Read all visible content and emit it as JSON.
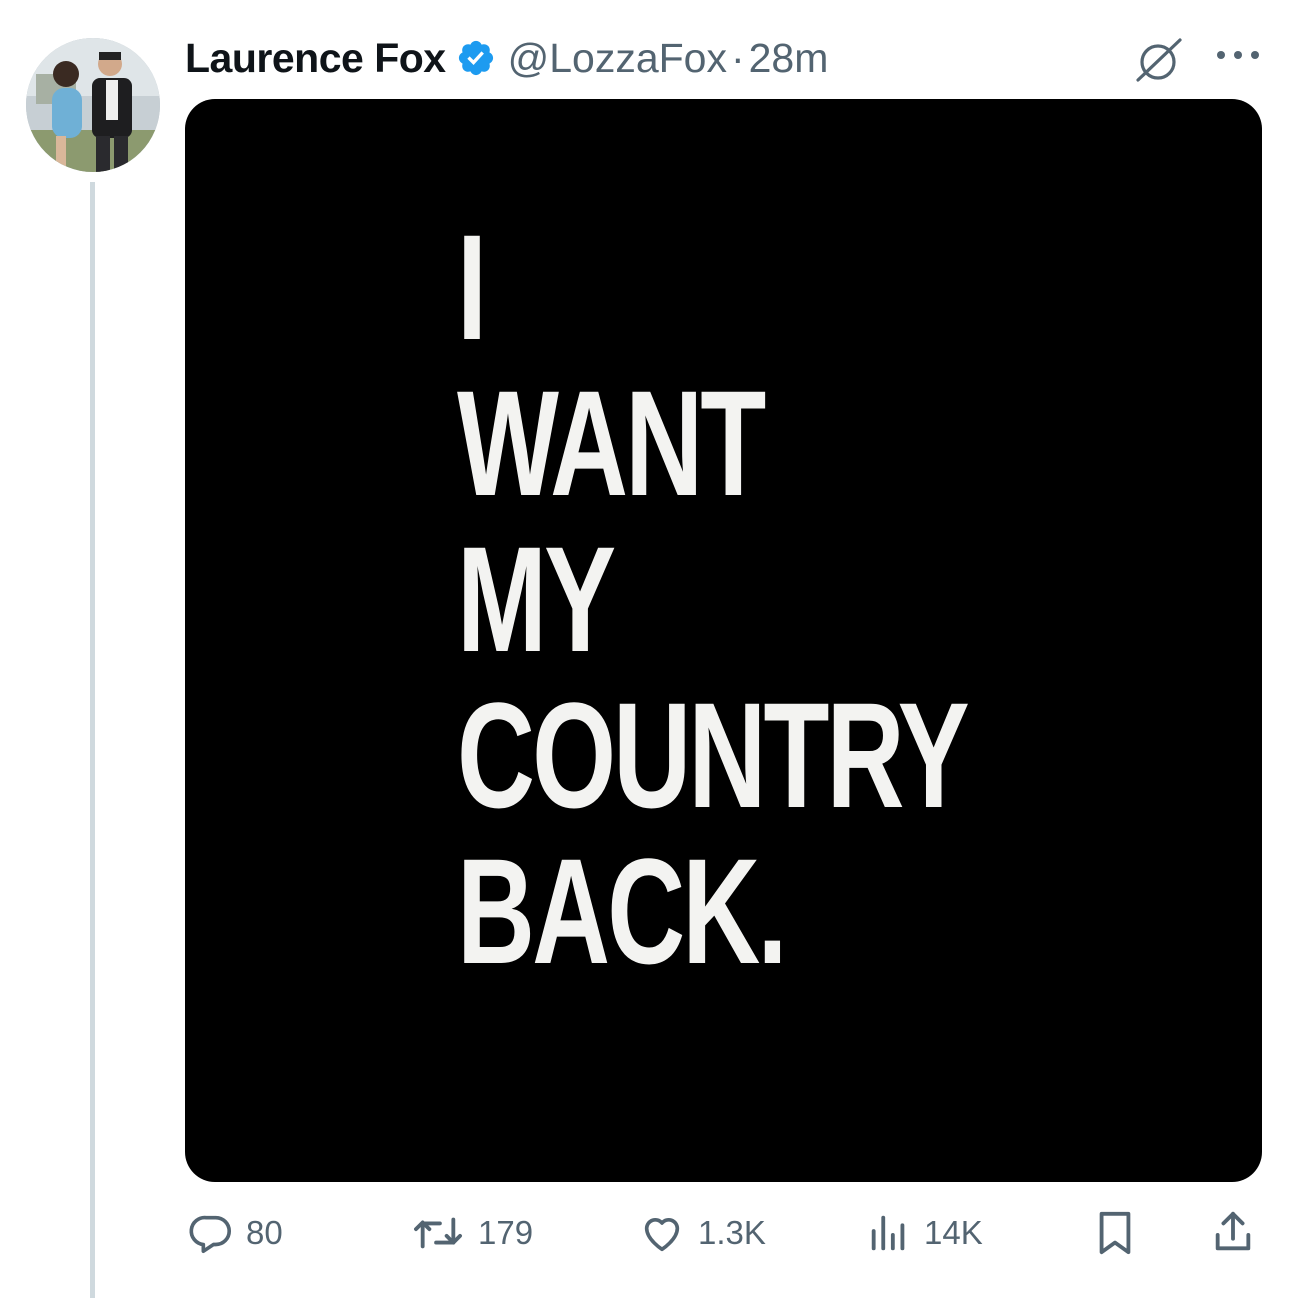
{
  "tweet": {
    "author_name": "Laurence Fox",
    "handle": "@LozzaFox",
    "separator": "·",
    "time": "28m",
    "verified": true,
    "verified_color": "#1d9bf0"
  },
  "media": {
    "text": "I\nWANT\nMY\nCOUNTRY\nBACK.",
    "background": "#000000",
    "text_color": "#f3f3f1"
  },
  "actions": {
    "replies": "80",
    "reposts": "179",
    "likes": "1.3K",
    "views": "14K"
  },
  "icons": {
    "header": [
      "grok-icon",
      "more-icon"
    ],
    "actions": [
      "reply-icon",
      "repost-icon",
      "like-icon",
      "views-icon",
      "bookmark-icon",
      "share-icon"
    ]
  }
}
